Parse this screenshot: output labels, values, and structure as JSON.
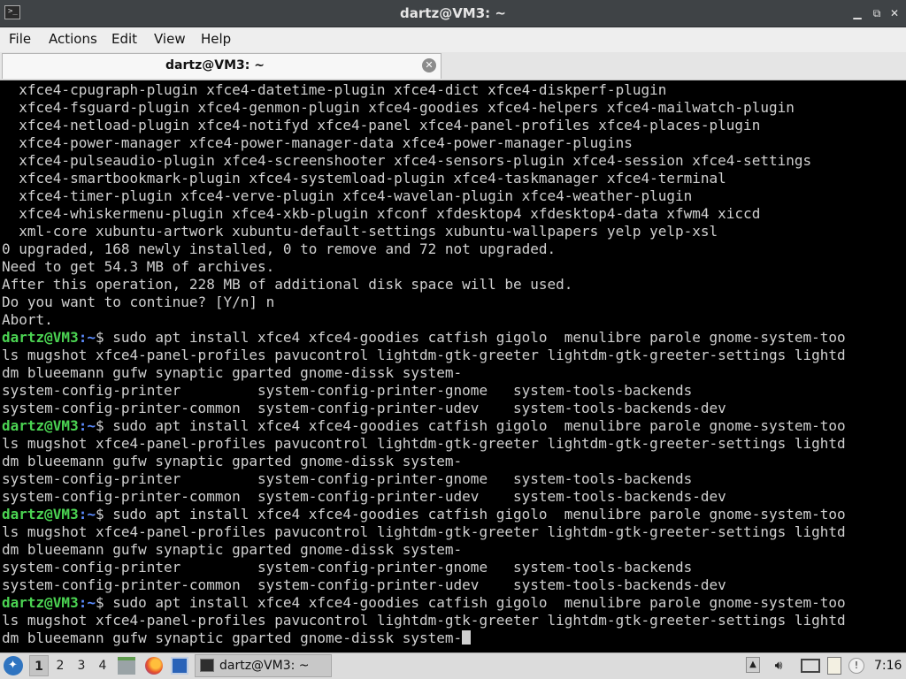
{
  "window": {
    "title": "dartz@VM3: ~",
    "min_glyph": "▁",
    "max_glyph": "⧉",
    "close_glyph": "✕",
    "icon_glyph": ">_"
  },
  "menu": {
    "items": [
      "File",
      "Actions",
      "Edit",
      "View",
      "Help"
    ]
  },
  "tab": {
    "label": "dartz@VM3: ~",
    "close_glyph": "✕"
  },
  "terminal": {
    "prompt_user": "dartz@VM3",
    "prompt_path": ":~",
    "prompt_symbol": "$",
    "lines": [
      {
        "t": "  xfce4-cpugraph-plugin xfce4-datetime-plugin xfce4-dict xfce4-diskperf-plugin"
      },
      {
        "t": "  xfce4-fsguard-plugin xfce4-genmon-plugin xfce4-goodies xfce4-helpers xfce4-mailwatch-plugin"
      },
      {
        "t": "  xfce4-netload-plugin xfce4-notifyd xfce4-panel xfce4-panel-profiles xfce4-places-plugin"
      },
      {
        "t": "  xfce4-power-manager xfce4-power-manager-data xfce4-power-manager-plugins"
      },
      {
        "t": "  xfce4-pulseaudio-plugin xfce4-screenshooter xfce4-sensors-plugin xfce4-session xfce4-settings"
      },
      {
        "t": "  xfce4-smartbookmark-plugin xfce4-systemload-plugin xfce4-taskmanager xfce4-terminal"
      },
      {
        "t": "  xfce4-timer-plugin xfce4-verve-plugin xfce4-wavelan-plugin xfce4-weather-plugin"
      },
      {
        "t": "  xfce4-whiskermenu-plugin xfce4-xkb-plugin xfconf xfdesktop4 xfdesktop4-data xfwm4 xiccd"
      },
      {
        "t": "  xml-core xubuntu-artwork xubuntu-default-settings xubuntu-wallpapers yelp yelp-xsl"
      },
      {
        "t": "0 upgraded, 168 newly installed, 0 to remove and 72 not upgraded."
      },
      {
        "t": "Need to get 54.3 MB of archives."
      },
      {
        "t": "After this operation, 228 MB of additional disk space will be used."
      },
      {
        "t": "Do you want to continue? [Y/n] n"
      },
      {
        "t": "Abort."
      },
      {
        "p": true,
        "t": " sudo apt install xfce4 xfce4-goodies catfish gigolo  menulibre parole gnome-system-too"
      },
      {
        "t": "ls mugshot xfce4-panel-profiles pavucontrol lightdm-gtk-greeter lightdm-gtk-greeter-settings lightd"
      },
      {
        "t": "dm blueemann gufw synaptic gparted gnome-dissk system-"
      },
      {
        "t": "system-config-printer         system-config-printer-gnome   system-tools-backends"
      },
      {
        "t": "system-config-printer-common  system-config-printer-udev    system-tools-backends-dev"
      },
      {
        "p": true,
        "t": " sudo apt install xfce4 xfce4-goodies catfish gigolo  menulibre parole gnome-system-too"
      },
      {
        "t": "ls mugshot xfce4-panel-profiles pavucontrol lightdm-gtk-greeter lightdm-gtk-greeter-settings lightd"
      },
      {
        "t": "dm blueemann gufw synaptic gparted gnome-dissk system-"
      },
      {
        "t": "system-config-printer         system-config-printer-gnome   system-tools-backends"
      },
      {
        "t": "system-config-printer-common  system-config-printer-udev    system-tools-backends-dev"
      },
      {
        "p": true,
        "t": " sudo apt install xfce4 xfce4-goodies catfish gigolo  menulibre parole gnome-system-too"
      },
      {
        "t": "ls mugshot xfce4-panel-profiles pavucontrol lightdm-gtk-greeter lightdm-gtk-greeter-settings lightd"
      },
      {
        "t": "dm blueemann gufw synaptic gparted gnome-dissk system-"
      },
      {
        "t": "system-config-printer         system-config-printer-gnome   system-tools-backends"
      },
      {
        "t": "system-config-printer-common  system-config-printer-udev    system-tools-backends-dev"
      },
      {
        "p": true,
        "t": " sudo apt install xfce4 xfce4-goodies catfish gigolo  menulibre parole gnome-system-too"
      },
      {
        "t": "ls mugshot xfce4-panel-profiles pavucontrol lightdm-gtk-greeter lightdm-gtk-greeter-settings lightd"
      },
      {
        "t": "dm blueemann gufw synaptic gparted gnome-dissk system-",
        "cursor": true
      }
    ]
  },
  "taskbar": {
    "workspaces": [
      "1",
      "2",
      "3",
      "4"
    ],
    "active_workspace": "1",
    "launchers": [
      {
        "icon": "file-manager-icon"
      },
      {
        "icon": "firefox-icon"
      },
      {
        "icon": "show-desktop-icon"
      }
    ],
    "task_label": "dartz@VM3: ~",
    "clock": "7:16",
    "tray_icons": [
      "updates-icon",
      "volume-icon",
      "network-icon",
      "clipboard-icon",
      "notification-icon"
    ]
  },
  "colors": {
    "prompt_user": "#4bd352",
    "prompt_path": "#5c8cff",
    "terminal_bg": "#000000",
    "terminal_fg": "#d0d0d0",
    "titlebar_bg": "#3f4346"
  }
}
